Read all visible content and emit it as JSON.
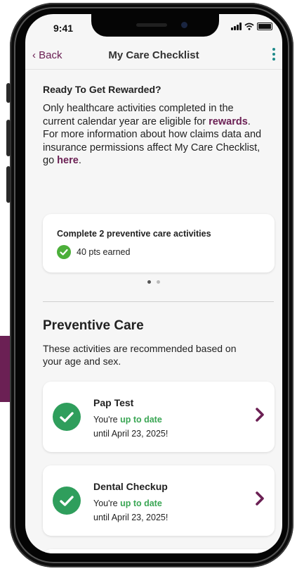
{
  "status_bar": {
    "time": "9:41"
  },
  "nav": {
    "back_label": "Back",
    "title": "My Care Checklist"
  },
  "rewards": {
    "heading": "Ready To Get Rewarded?",
    "para_part1": "Only healthcare activities completed in the current calendar year are eligible for ",
    "rewards_link": "rewards",
    "para_part2": ". For more information about how claims data and insurance permissions affect My Care Checklist, go ",
    "here_link": "here",
    "para_part3": "."
  },
  "reward_card": {
    "title": "Complete 2 preventive care activities",
    "points": "40 pts earned"
  },
  "carousel": {
    "total": 2,
    "active_index": 0
  },
  "preventive": {
    "heading": "Preventive Care",
    "description": "These activities are recommended based on your age and sex.",
    "items": [
      {
        "name": "Pap Test",
        "prefix": "You're ",
        "status": "up to date",
        "until": "until April 23, 2025!"
      },
      {
        "name": "Dental Checkup",
        "prefix": "You're ",
        "status": "up to date",
        "until": "until April 23, 2025!"
      }
    ]
  },
  "colors": {
    "brand_plum": "#6b2054",
    "check_green": "#2f9e5c",
    "status_green": "#3aa654",
    "menu_teal": "#1f8a8a"
  }
}
